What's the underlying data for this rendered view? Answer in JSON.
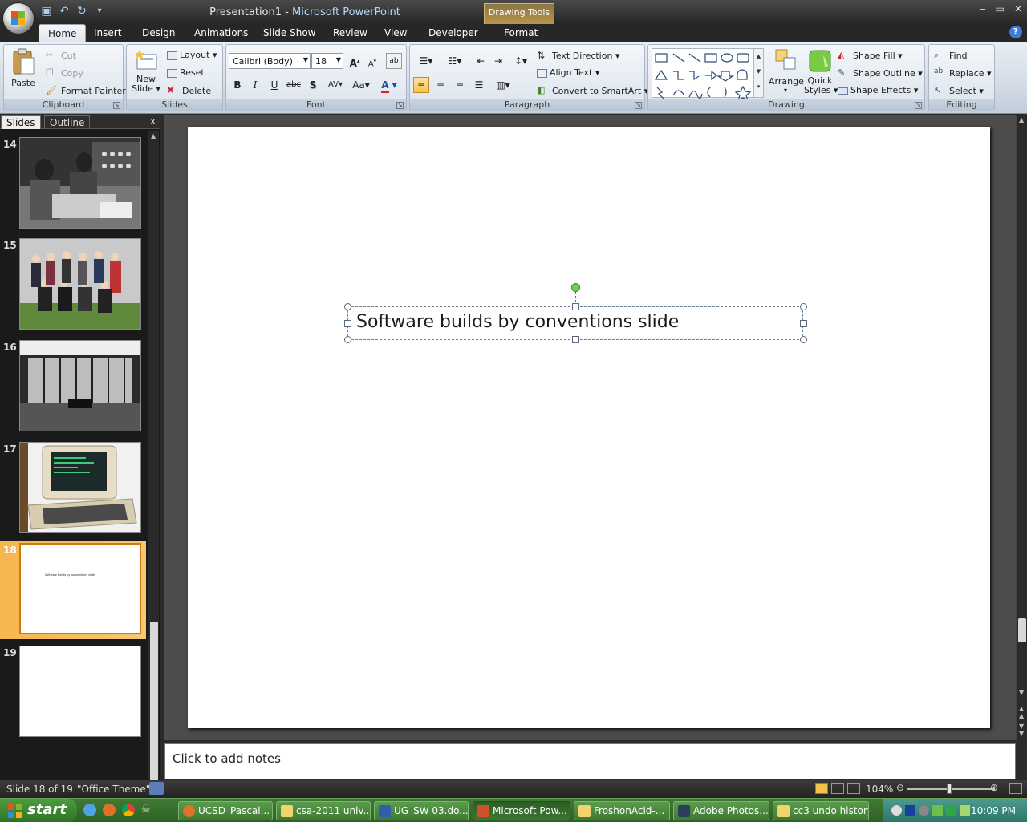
{
  "titlebar": {
    "doc_title": "Presentation1",
    "separator": " - ",
    "app_name": "Microsoft PowerPoint",
    "contextual_tab": "Drawing Tools",
    "controls": [
      "‒",
      "▭",
      "✕"
    ]
  },
  "tabs": [
    "Home",
    "Insert",
    "Design",
    "Animations",
    "Slide Show",
    "Review",
    "View",
    "Developer",
    "Format"
  ],
  "ribbon": {
    "clipboard": {
      "label": "Clipboard",
      "paste": "Paste",
      "cut": "Cut",
      "copy": "Copy",
      "format_painter": "Format Painter"
    },
    "slides": {
      "label": "Slides",
      "new_slide_1": "New",
      "new_slide_2": "Slide ▾",
      "layout": "Layout ▾",
      "reset": "Reset",
      "delete": "Delete"
    },
    "font": {
      "label": "Font",
      "font_name": "Calibri (Body)",
      "font_size": "18",
      "bold": "B",
      "italic": "I",
      "underline": "U",
      "strike": "abc",
      "shadow": "S",
      "spacing": "AV",
      "case": "Aa",
      "color": "A"
    },
    "paragraph": {
      "label": "Paragraph",
      "text_direction": "Text Direction ▾",
      "align_text": "Align Text ▾",
      "convert_smartart": "Convert to SmartArt ▾"
    },
    "drawing": {
      "label": "Drawing",
      "arrange": "Arrange",
      "quick_styles_1": "Quick",
      "quick_styles_2": "Styles ▾",
      "shape_fill": "Shape Fill ▾",
      "shape_outline": "Shape Outline ▾",
      "shape_effects": "Shape Effects ▾"
    },
    "editing": {
      "label": "Editing",
      "find": "Find",
      "replace": "Replace ▾",
      "select": "Select ▾"
    }
  },
  "leftpanel": {
    "tab_slides": "Slides",
    "tab_outline": "Outline",
    "close": "x",
    "thumbnails": [
      {
        "num": "14"
      },
      {
        "num": "15"
      },
      {
        "num": "16"
      },
      {
        "num": "17"
      },
      {
        "num": "18",
        "text": "Software builds by conventions slide"
      },
      {
        "num": "19"
      }
    ]
  },
  "slide": {
    "text": "Software builds by conventions slide"
  },
  "notes": {
    "placeholder": "Click to add notes"
  },
  "statusbar": {
    "slide_info": "Slide 18 of 19",
    "theme": "\"Office Theme\"",
    "zoom": "104%"
  },
  "taskbar": {
    "start": "start",
    "items": [
      "UCSD_Pascal...",
      "csa-2011 univ...",
      "UG_SW 03.do...",
      "Microsoft Pow...",
      "FroshonAcid-...",
      "Adobe Photos...",
      "cc3 undo history"
    ],
    "clock": "10:09 PM"
  },
  "colors": {
    "selection_accent": "#f7b54d",
    "ribbon_bg": "#dfe5ed",
    "rotation_handle": "#6ed04a"
  }
}
